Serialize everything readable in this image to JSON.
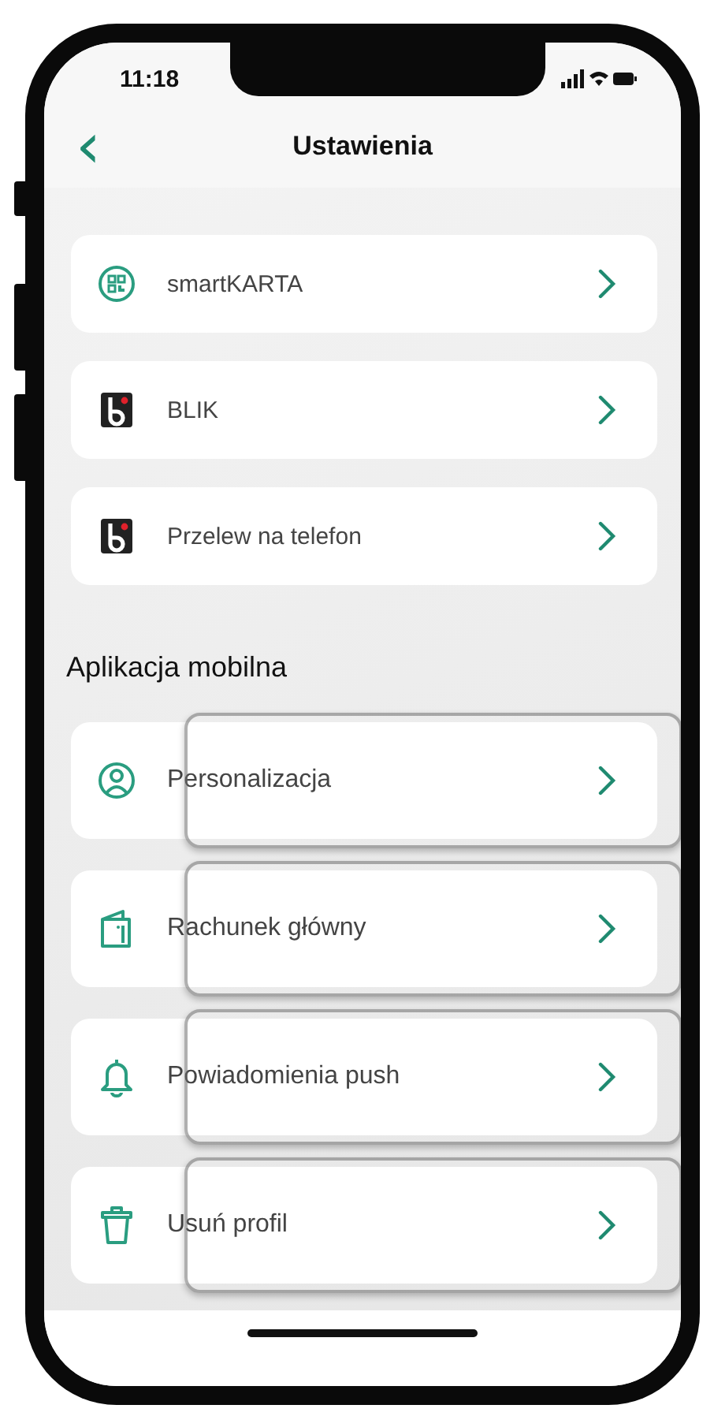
{
  "status_bar": {
    "time": "11:18"
  },
  "header": {
    "back": "‹",
    "title": "Ustawienia"
  },
  "payments": [
    {
      "kind": "qr",
      "label": "smartKARTA",
      "highlighted": false
    },
    {
      "kind": "blik",
      "label": "BLIK",
      "highlighted": false
    },
    {
      "kind": "blik",
      "label": "Przelew na telefon",
      "highlighted": false
    }
  ],
  "mobile_section": {
    "title": "Aplikacja mobilna",
    "items": [
      {
        "kind": "person",
        "label": "Personalizacja",
        "highlighted": true
      },
      {
        "kind": "wallet",
        "label": "Rachunek główny",
        "highlighted": true
      },
      {
        "kind": "bell",
        "label": "Powiadomienia push",
        "highlighted": true
      },
      {
        "kind": "trash",
        "label": "Usuń profil",
        "highlighted": true
      }
    ]
  }
}
